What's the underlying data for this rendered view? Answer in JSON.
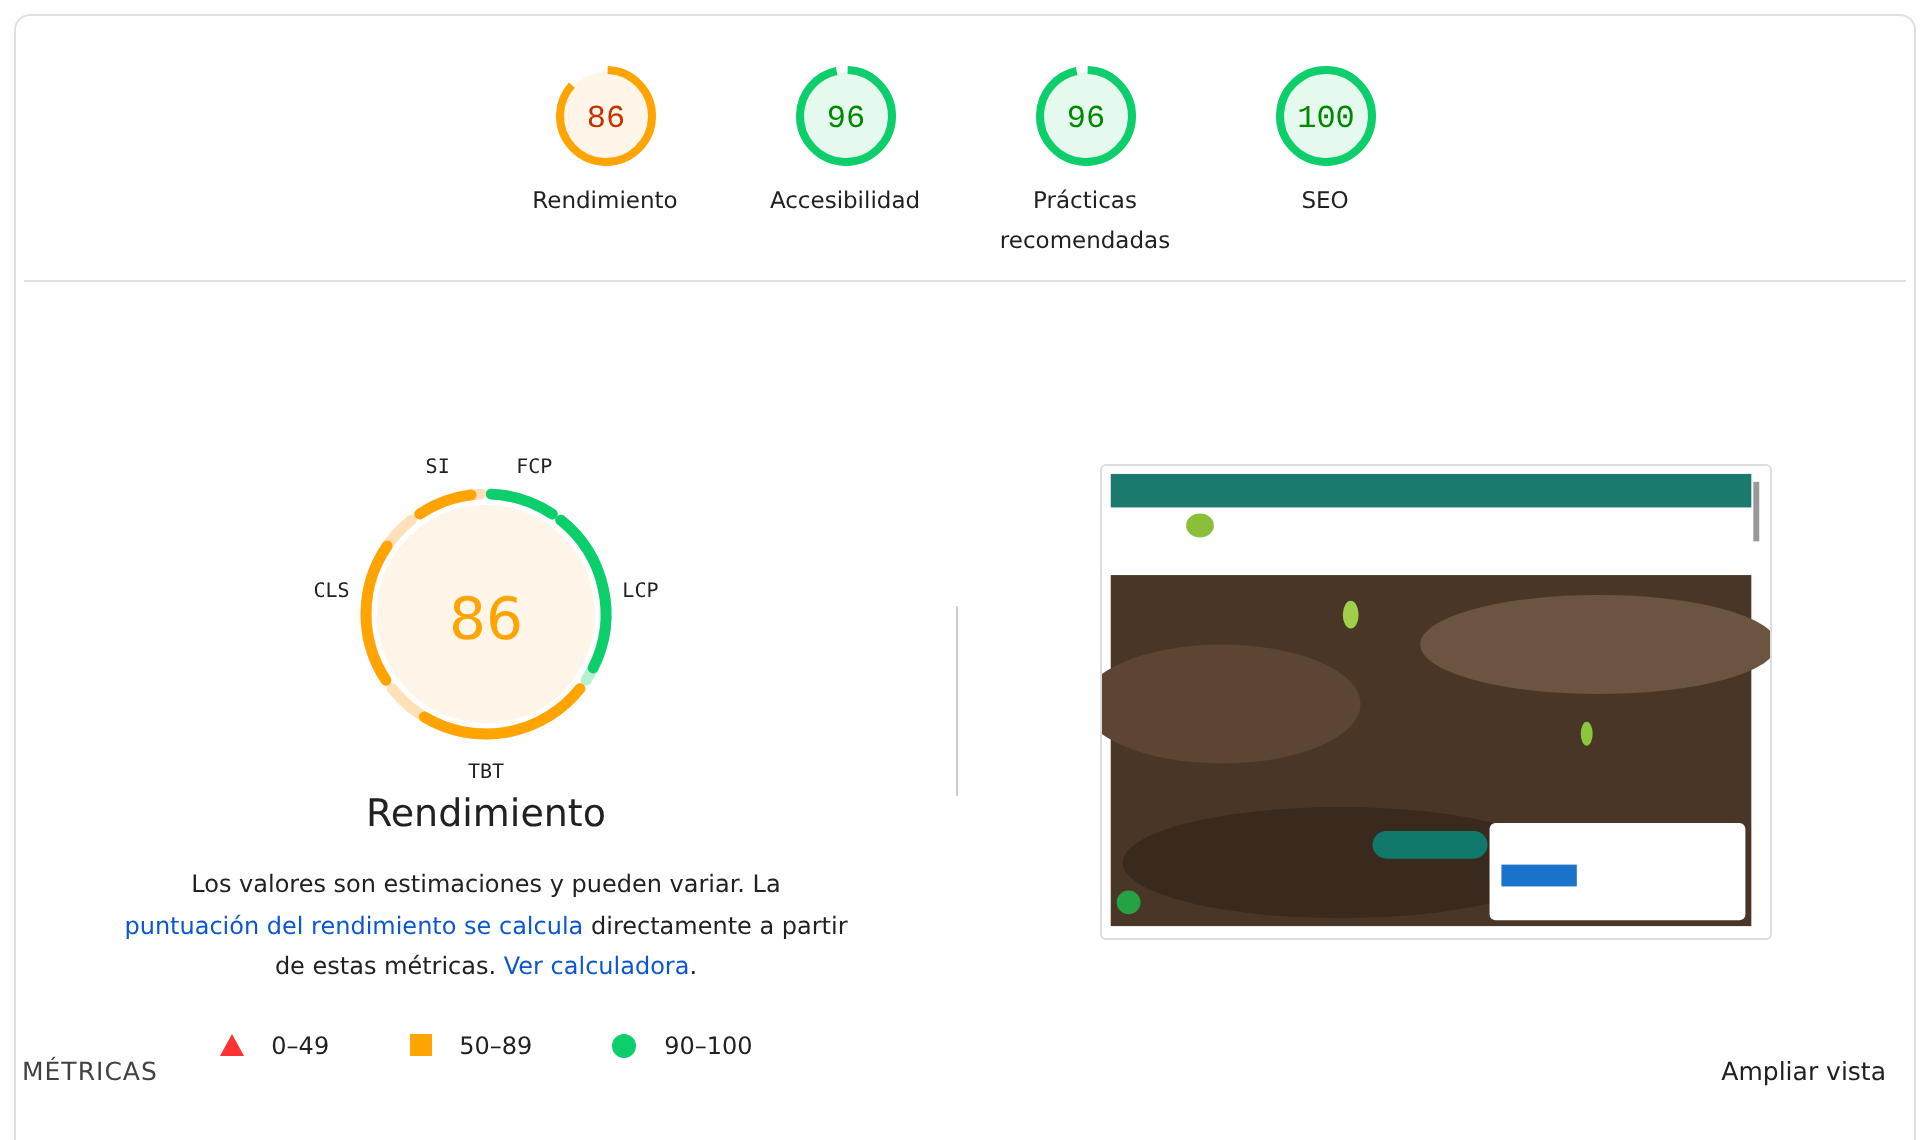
{
  "categories": [
    {
      "score": "86",
      "label": "Rendimiento"
    },
    {
      "score": "96",
      "label": "Accesibilidad"
    },
    {
      "score": "96",
      "label": "Prácticas recomendadas"
    },
    {
      "score": "100",
      "label": "SEO"
    }
  ],
  "performance": {
    "score": "86",
    "title": "Rendimiento",
    "metrics": [
      {
        "label": "FCP",
        "level": 1.0
      },
      {
        "label": "LCP",
        "level": 0.92
      },
      {
        "label": "TBT",
        "level": 0.8
      },
      {
        "label": "CLS",
        "level": 0.8
      },
      {
        "label": "SI",
        "level": 0.85
      }
    ],
    "description": [
      {
        "kind": "text",
        "text": "Los valores son estimaciones y pueden variar. La "
      },
      {
        "kind": "link",
        "text": "puntuación del rendimiento se calcula"
      },
      {
        "kind": "text",
        "text": " directamente a partir de estas métricas. "
      },
      {
        "kind": "link",
        "text": "Ver calculadora"
      },
      {
        "kind": "text",
        "text": "."
      }
    ],
    "legend": [
      {
        "kind": "fail",
        "range": "0–49"
      },
      {
        "kind": "average",
        "range": "50–89"
      },
      {
        "kind": "pass",
        "range": "90–100"
      }
    ]
  },
  "metrics_header": {
    "title": "MÉTRICAS",
    "toggle": "Ampliar vista"
  }
}
